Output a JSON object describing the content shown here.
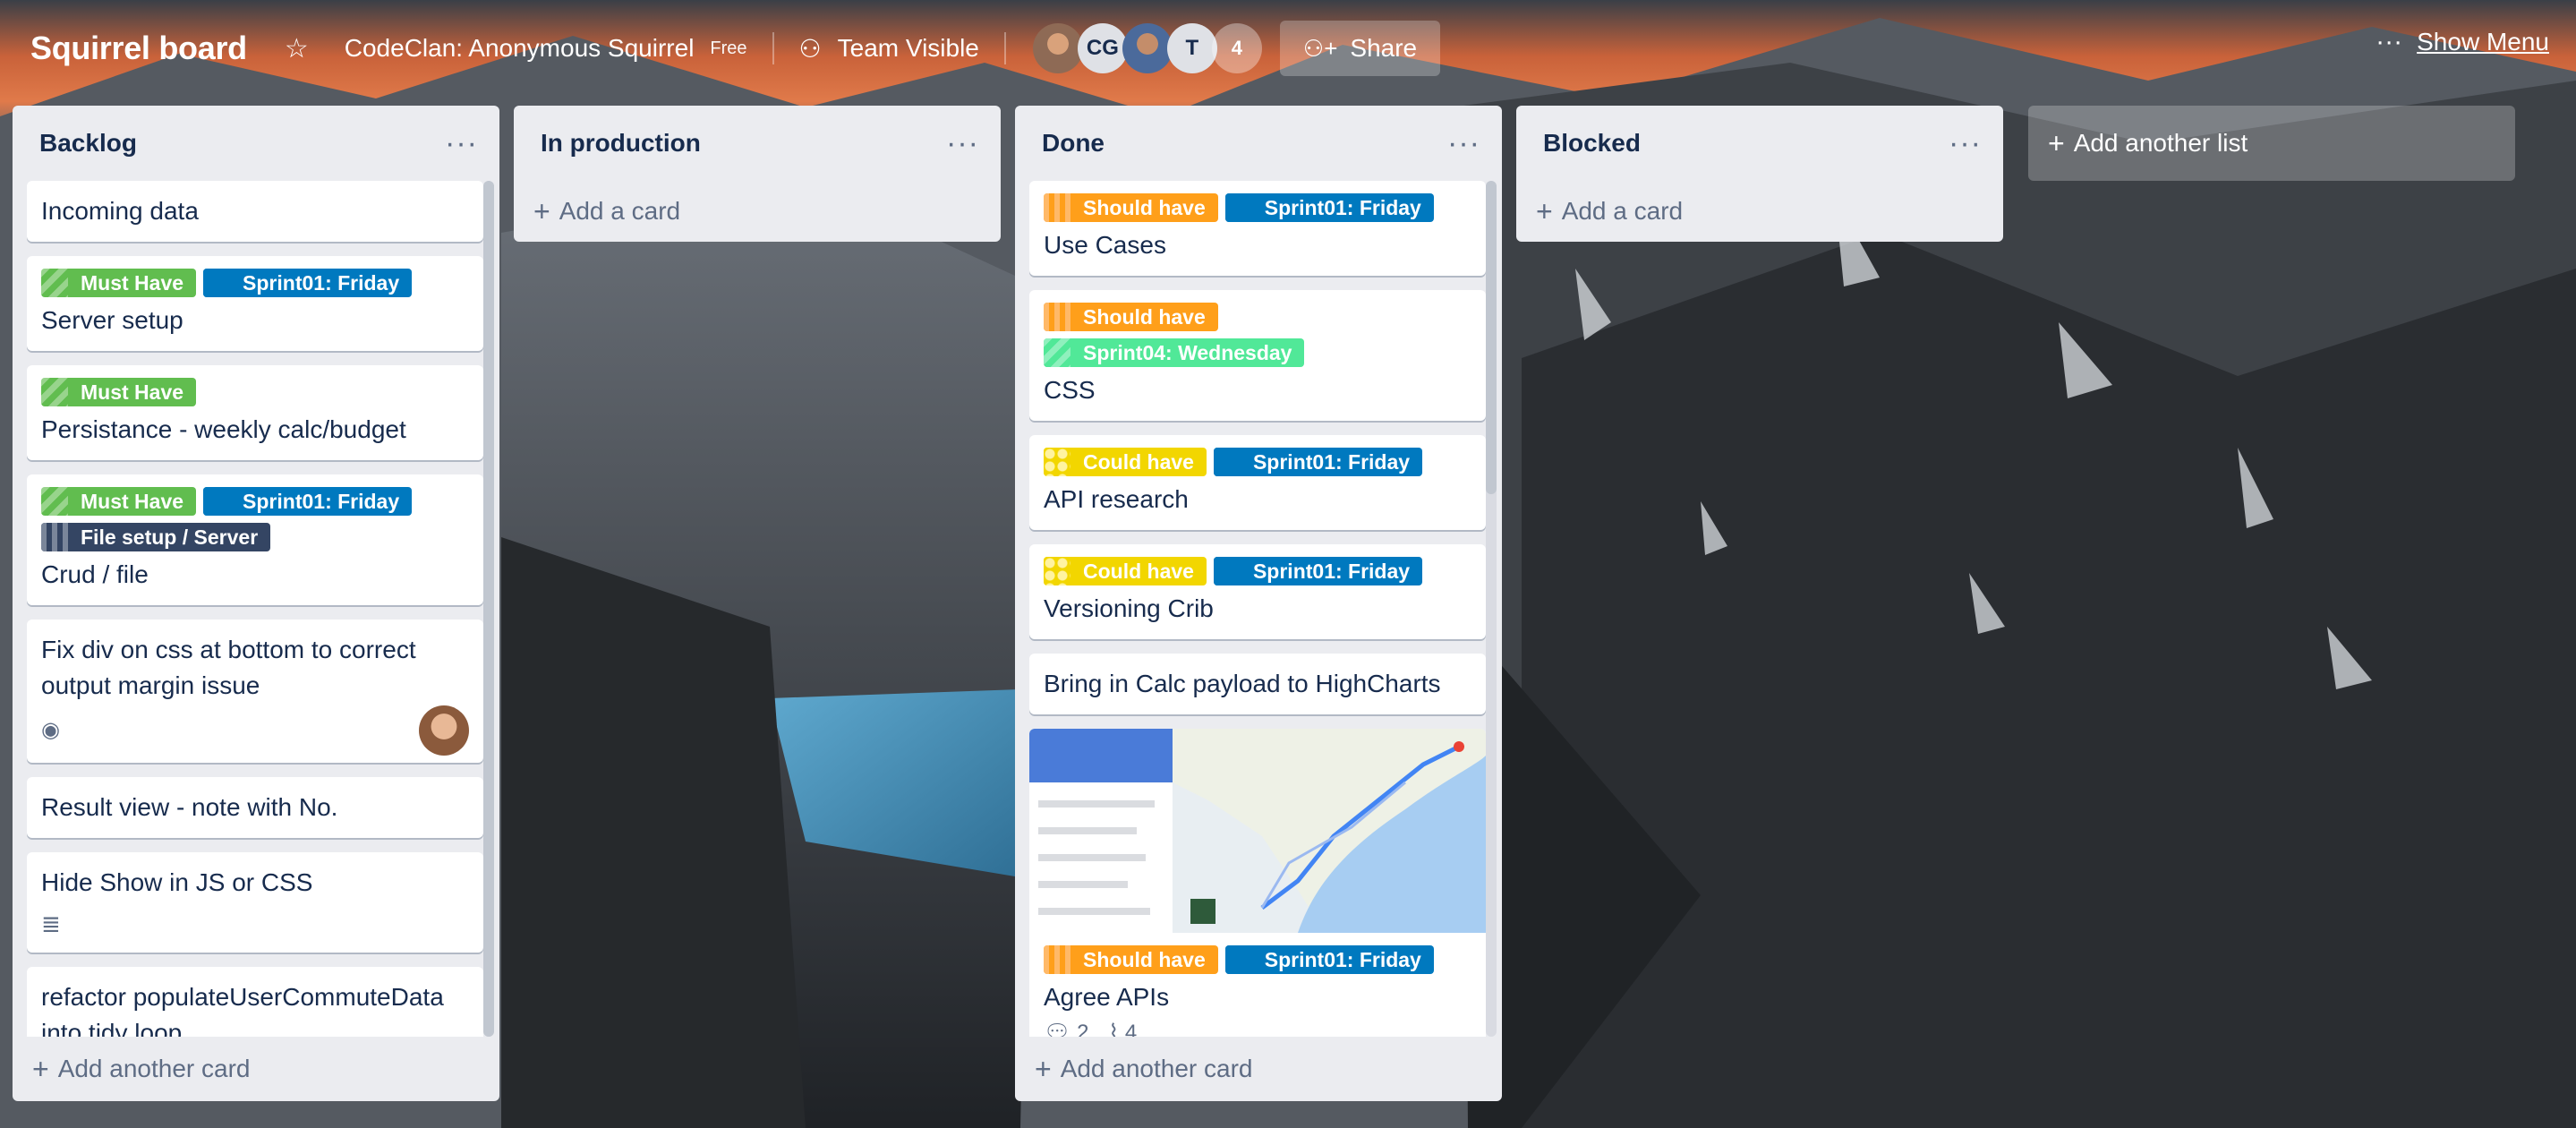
{
  "header": {
    "board_title": "Squirrel board",
    "team_name": "CodeClan: Anonymous Squirrel",
    "team_badge": "Free",
    "visibility": "Team Visible",
    "members": [
      {
        "initials": "",
        "name": "avatar-photo-1"
      },
      {
        "initials": "CG",
        "name": "avatar-cg"
      },
      {
        "initials": "",
        "name": "avatar-photo-2"
      },
      {
        "initials": "T",
        "name": "avatar-t"
      }
    ],
    "member_overflow": "4",
    "share_label": "Share",
    "show_menu_label": "Show Menu"
  },
  "lists": [
    {
      "title": "Backlog",
      "add_card": "Add another card",
      "cards": [
        {
          "title": "Incoming data"
        },
        {
          "title": "Server setup",
          "labels": [
            {
              "text": "Must Have",
              "color": "#61bd4f"
            },
            {
              "text": "Sprint01: Friday",
              "color": "#0079bf"
            }
          ]
        },
        {
          "title": "Persistance - weekly calc/budget",
          "labels": [
            {
              "text": "Must Have",
              "color": "#61bd4f"
            }
          ]
        },
        {
          "title": "Crud / file",
          "labels": [
            {
              "text": "Must Have",
              "color": "#61bd4f"
            },
            {
              "text": "Sprint01: Friday",
              "color": "#0079bf"
            },
            {
              "text": "File setup / Server",
              "color": "#344563"
            }
          ]
        },
        {
          "title": "Fix div on css at bottom to correct output margin issue",
          "badges": [
            "eye-icon",
            "member-avatar"
          ]
        },
        {
          "title": "Result view - note with No."
        },
        {
          "title": "Hide Show in JS or CSS",
          "badges": [
            "description-icon"
          ]
        },
        {
          "title": "refactor populateUserCommuteData into tidy loop"
        }
      ]
    },
    {
      "title": "In production",
      "add_card": "Add a card",
      "cards": []
    },
    {
      "title": "Done",
      "add_card": "Add another card",
      "cards": [
        {
          "title": "Use Cases",
          "labels": [
            {
              "text": "Should have",
              "color": "#ff9f1a"
            },
            {
              "text": "Sprint01: Friday",
              "color": "#0079bf"
            }
          ]
        },
        {
          "title": "CSS",
          "labels": [
            {
              "text": "Should have",
              "color": "#ff9f1a"
            },
            {
              "text": "Sprint04: Wednesday",
              "color": "#51e898"
            }
          ]
        },
        {
          "title": "API research",
          "labels": [
            {
              "text": "Could have",
              "color": "#f2d600"
            },
            {
              "text": "Sprint01: Friday",
              "color": "#0079bf"
            }
          ]
        },
        {
          "title": "Versioning Crib",
          "labels": [
            {
              "text": "Could have",
              "color": "#f2d600"
            },
            {
              "text": "Sprint01: Friday",
              "color": "#0079bf"
            }
          ]
        },
        {
          "title": "Bring in Calc payload to HighCharts"
        },
        {
          "title": "Agree APIs",
          "cover": "map-screenshot",
          "labels": [
            {
              "text": "Should have",
              "color": "#ff9f1a"
            },
            {
              "text": "Sprint01: Friday",
              "color": "#0079bf"
            }
          ],
          "comments": "2",
          "attachments": "4"
        }
      ]
    },
    {
      "title": "Blocked",
      "add_card": "Add a card",
      "cards": []
    }
  ],
  "add_list": "Add another list",
  "icons": {
    "star": "star-icon",
    "visibility": "people-icon",
    "share": "add-person-icon",
    "menu": "more-horizontal-icon",
    "add": "plus-icon"
  },
  "colors": {
    "list_bg": "#ebecf0",
    "card_bg": "#ffffff",
    "text": "#172b4d",
    "muted": "#5e6c84"
  }
}
